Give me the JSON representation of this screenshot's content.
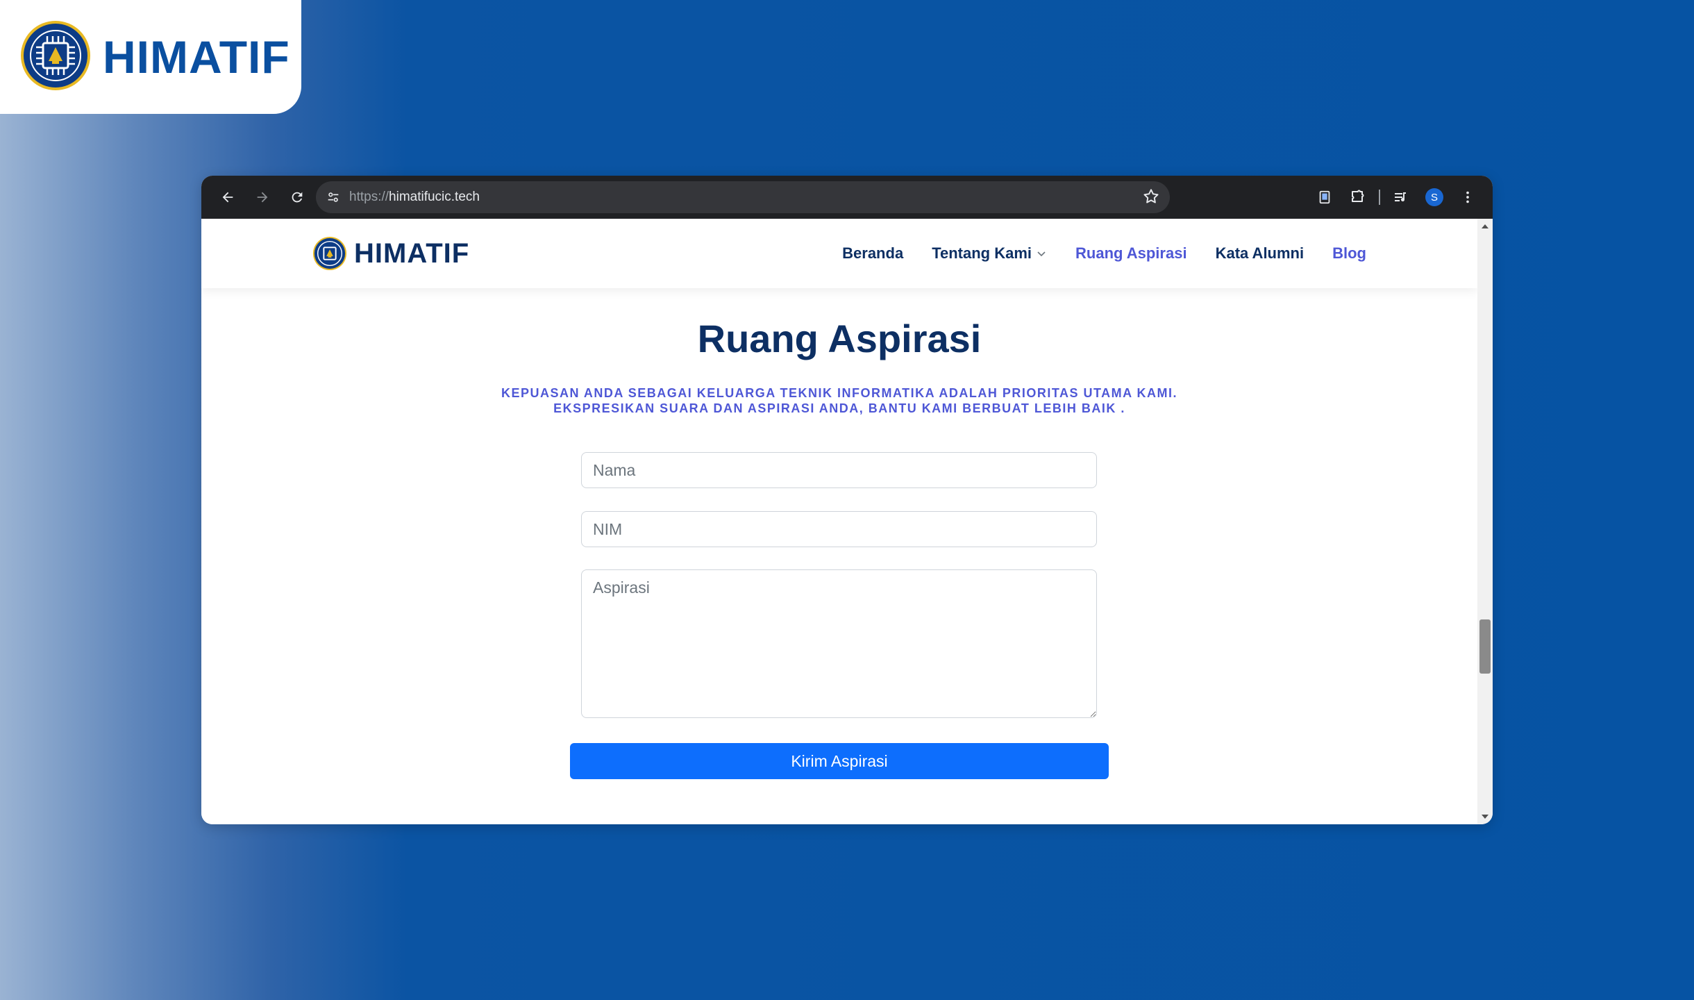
{
  "brand": {
    "badge_text": "HIMATIF"
  },
  "browser": {
    "url_scheme": "https://",
    "url_host": "himatifucic.tech",
    "profile_initial": "S"
  },
  "site": {
    "logo_text": "HIMATIF",
    "nav": [
      {
        "label": "Beranda"
      },
      {
        "label": "Tentang Kami",
        "has_dropdown": true
      },
      {
        "label": "Ruang Aspirasi",
        "active": true
      },
      {
        "label": "Kata Alumni"
      },
      {
        "label": "Blog"
      }
    ]
  },
  "content": {
    "title": "Ruang Aspirasi",
    "subtitle_line1": "KEPUASAN ANDA SEBAGAI KELUARGA TEKNIK INFORMATIKA ADALAH PRIORITAS UTAMA KAMI.",
    "subtitle_line2": "EKSPRESIKAN SUARA DAN ASPIRASI ANDA, BANTU KAMI BERBUAT LEBIH BAIK .",
    "form": {
      "nama_placeholder": "Nama",
      "nim_placeholder": "NIM",
      "aspirasi_placeholder": "Aspirasi",
      "submit_label": "Kirim Aspirasi"
    }
  },
  "colors": {
    "navy": "#0d2f63",
    "accent": "#4e57d6",
    "primary_button": "#0d6efd",
    "background_blue": "#0653a3"
  },
  "icons": [
    "back-arrow-icon",
    "forward-arrow-icon",
    "reload-icon",
    "site-settings-icon",
    "bookmark-star-icon",
    "reading-list-icon",
    "extensions-icon",
    "media-controls-icon",
    "profile-avatar",
    "more-menu-icon",
    "himatif-logo",
    "chevron-down-icon"
  ]
}
